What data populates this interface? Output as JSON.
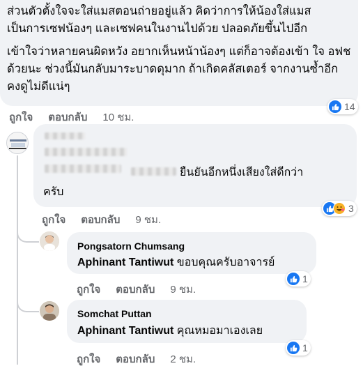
{
  "top_comment": {
    "paragraphs": [
      "ส่วนตัวตั้งใจจะใส่แมสตอนถ่ายอยู่แล้ว คิดว่าการให้น้องใส่แมส เป็นการเซฟน้องๆ และเซฟคนในงานไปด้วย ปลอดภัยขึ้นไปอีก",
      "เข้าใจว่าหลายคนผิดหวัง อยากเห็นหน้าน้องๆ แต่ก็อาจต้องเข้า ใจ อฟช ด้วยนะ ช่วงนี้มันกลับมาระบาดดุมาก ถ้าเกิดคลัสเตอร์ จากงานซ้ำอีก คงดูไม่ดีแน่ๆ"
    ],
    "reaction_count": "14",
    "like_label": "ถูกใจ",
    "reply_label": "ตอบกลับ",
    "time": "10 ชม."
  },
  "reply1": {
    "visible_text_line1": "ยืนยันอีกหนึ่งเสียงใส่ดีกว่า",
    "visible_text_line2": "ครับ",
    "reaction_count": "3",
    "like_label": "ถูกใจ",
    "reply_label": "ตอบกลับ",
    "time": "9 ชม."
  },
  "reply2": {
    "author": "Pongsatorn Chumsang",
    "mention": "Aphinant Tantiwut",
    "text": " ขอบคุณครับอาจารย์",
    "reaction_count": "1",
    "like_label": "ถูกใจ",
    "reply_label": "ตอบกลับ",
    "time": "9 ชม."
  },
  "reply3": {
    "author": "Somchat Puttan",
    "mention": "Aphinant Tantiwut",
    "text": " คุณหมอมาเองเลย",
    "reaction_count": "1",
    "like_label": "ถูกใจ",
    "reply_label": "ตอบกลับ",
    "time": "2 ชม."
  },
  "icons": {
    "like": "like-reaction-icon",
    "haha": "haha-reaction-icon"
  },
  "colors": {
    "bubble": "#f0f2f5",
    "meta_text": "#65676b",
    "like_blue": "#1877f2",
    "thread_line": "#ced0d4"
  }
}
